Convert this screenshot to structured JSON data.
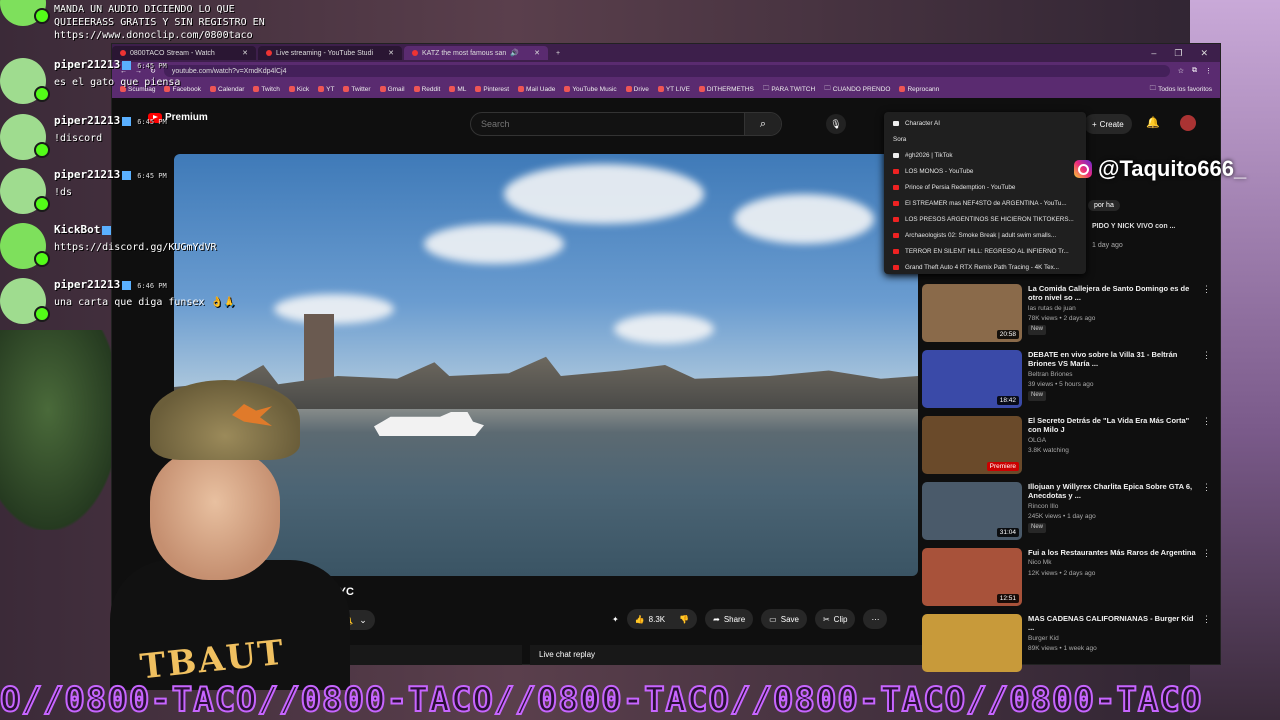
{
  "browser": {
    "tabs": [
      {
        "label": "0800TACO Stream - Watch",
        "active": false
      },
      {
        "label": "Live streaming - YouTube Studi",
        "active": false
      },
      {
        "label": "KATZ the most famous san",
        "active": true
      }
    ],
    "url": "youtube.com/watch?v=XmdKdp4lCj4",
    "bookmarks": [
      "Scumbag",
      "Facebook",
      "Calendar",
      "Twitch",
      "Kick",
      "YT",
      "Twitter",
      "Gmail",
      "Reddit",
      "ML",
      "Pinterest",
      "Mail Uade",
      "YouTube Music",
      "Drive",
      "YT LIVE",
      "DITHERMETHS",
      "PARA TWITCH",
      "CUANDO PRENDO",
      "Reprocann"
    ],
    "bookmarks_all": "Todos los favoritos",
    "bookmark_folder_items": [
      "Character AI",
      "Sora",
      "#gh2026 | TikTok",
      "LOS MONOS - YouTube",
      "Prince of Persia Redemption - YouTube",
      "El STREAMER mas NEF4STO de ARGENTINA - YouTu...",
      "LOS PRESOS ARGENTINOS SE HICIERON TIKTOKERS...",
      "Archaeologists 02: Smoke Break | adult swim smalls...",
      "TERROR EN SILENT HILL: REGRESO AL INFIERNO Tr...",
      "Grand Theft Auto 4 RTX Remix Path Tracing - 4K Tex..."
    ]
  },
  "youtube": {
    "logo_text": "Premium",
    "search_placeholder": "Search",
    "create_label": "Create",
    "video_title_partial": "ch in NYC",
    "likes": "8.3K",
    "share_label": "Share",
    "save_label": "Save",
    "clip_label": "Clip",
    "live_chat_replay": "Live chat replay",
    "filter_chip": "por ha",
    "partial_rec": {
      "title": "PIDO Y NICK VIVO con ...",
      "meta": "1 day ago"
    },
    "recommendations": [
      {
        "title": "La Comida Callejera de Santo Domingo es de otro nivel so ...",
        "channel": "las rutas de juan",
        "stats": "78K views • 2 days ago",
        "badge": "New",
        "duration": "20:58",
        "thumb_color": "#8a6a4a"
      },
      {
        "title": "DEBATE en vivo sobre la Villa 31 - Beltrán Briones VS María ...",
        "channel": "Beltran Briones",
        "stats": "39 views • 5 hours ago",
        "badge": "New",
        "duration": "18:42",
        "thumb_color": "#3a4aa8"
      },
      {
        "title": "El Secreto Detrás de \"La Vida Era Más Corta\" con Milo J",
        "channel": "OLGA",
        "stats": "3.8K watching",
        "badge": "",
        "duration": "Premiere",
        "thumb_color": "#6a4a2a"
      },
      {
        "title": "Illojuan y Willyrex Charlita Epica Sobre GTA 6, Anecdotas y ...",
        "channel": "Rincon Illo",
        "stats": "245K views • 1 day ago",
        "badge": "New",
        "duration": "31:04",
        "thumb_color": "#4a5a6a"
      },
      {
        "title": "Fui a los Restaurantes Más Raros de Argentina",
        "channel": "Nico Mk",
        "stats": "12K views • 2 days ago",
        "badge": "",
        "duration": "12:51",
        "thumb_color": "#a8523a"
      },
      {
        "title": "MAS CADENAS CALIFORNIANAS - Burger Kid ...",
        "channel": "Burger Kid",
        "stats": "89K views • 1 week ago",
        "badge": "",
        "duration": "",
        "thumb_color": "#c89a3a"
      }
    ]
  },
  "overlay": {
    "instagram": "@Taquito666_",
    "ticker": "O//0800-TACO//0800-TACO//0800-TACO//0800-TACO//0800-TACO",
    "shirt_print": "TBAUT",
    "chat": [
      {
        "user": "",
        "time": "",
        "text_lines": [
          "MANDA UN AUDIO DICIENDO LO QUE",
          "QUIEEERASS GRATIS Y SIN REGISTRO EN",
          "https://www.donoclip.com/0800taco"
        ],
        "bot": false
      },
      {
        "user": "piper21213",
        "time": "6:45 PM",
        "text_lines": [
          "es el gato que piensa"
        ],
        "bot": false
      },
      {
        "user": "piper21213",
        "time": "6:45 PM",
        "text_lines": [
          "!discord"
        ],
        "bot": false
      },
      {
        "user": "piper21213",
        "time": "6:45 PM",
        "text_lines": [
          "!ds"
        ],
        "bot": false
      },
      {
        "user": "KickBot",
        "time": "",
        "text_lines": [
          "https://discord.gg/KUGmYdVR"
        ],
        "bot": true
      },
      {
        "user": "piper21213",
        "time": "6:46 PM",
        "text_lines": [
          "una carta que diga funsex 👌🙏"
        ],
        "bot": false
      }
    ]
  }
}
